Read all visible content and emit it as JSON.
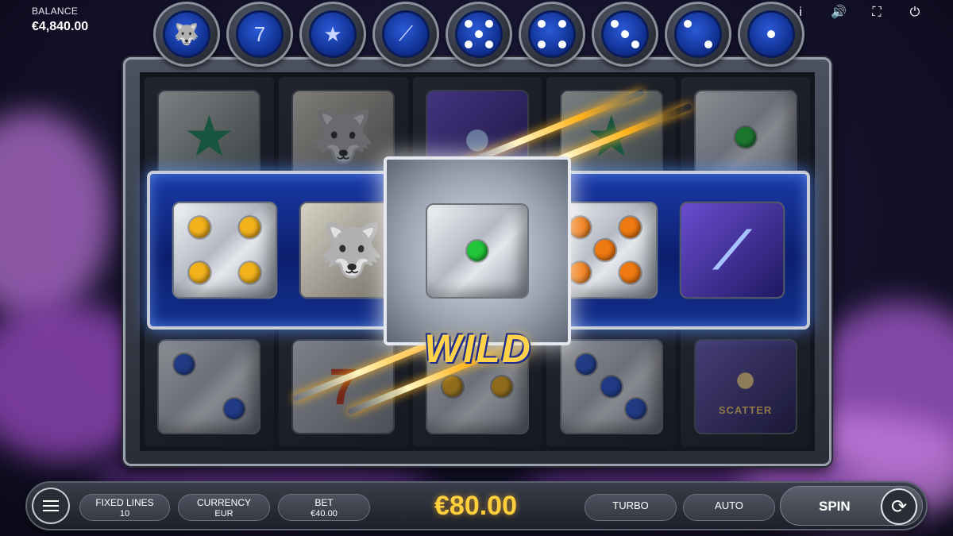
{
  "balance": {
    "label": "BALANCE",
    "value": "€4,840.00"
  },
  "top_icons": {
    "info": "i",
    "sound": "🔊",
    "fullscreen": "⛶",
    "power": "⏻"
  },
  "paytable": [
    {
      "icon": "wolf-icon",
      "glyph": "🐺"
    },
    {
      "icon": "seven-icon",
      "glyph": "7"
    },
    {
      "icon": "star-icon",
      "glyph": "★"
    },
    {
      "icon": "claw-icon",
      "glyph": "⟋"
    },
    {
      "icon": "dice-five-icon",
      "pips": [
        1,
        0,
        1,
        0,
        1,
        0,
        1,
        0,
        1
      ]
    },
    {
      "icon": "dice-four-icon",
      "pips": [
        1,
        0,
        1,
        0,
        0,
        0,
        1,
        0,
        1
      ]
    },
    {
      "icon": "dice-three-icon",
      "pips": [
        1,
        0,
        0,
        0,
        1,
        0,
        0,
        0,
        1
      ]
    },
    {
      "icon": "dice-two-icon",
      "pips": [
        1,
        0,
        0,
        0,
        0,
        0,
        0,
        0,
        1
      ]
    },
    {
      "icon": "dice-one-icon",
      "pips": [
        0,
        0,
        0,
        0,
        1,
        0,
        0,
        0,
        0
      ]
    }
  ],
  "reels": {
    "top_row": [
      "star",
      "wolf",
      "scatter-moon",
      "star",
      "die-1-green"
    ],
    "middle_row": [
      "die-4-yellow",
      "wolf",
      "wild-die-1-green",
      "die-5-orange",
      "claw"
    ],
    "bottom_row": [
      "die-2-blue",
      "seven",
      "die-2-yellow",
      "die-3-blue",
      "scatter"
    ]
  },
  "wild_label": "WILD",
  "scatter_label": "SCATTER",
  "colors": {
    "pip_yellow": "#f2b21c",
    "pip_orange": "#f07a12",
    "pip_green": "#22c43a",
    "pip_blue": "#2a58d8",
    "win_accent": "#ffcf3c"
  },
  "bottom_bar": {
    "fixed_lines": {
      "label": "FIXED LINES",
      "value": "10"
    },
    "currency": {
      "label": "CURRENCY",
      "value": "EUR"
    },
    "bet": {
      "label": "BET",
      "value": "€40.00"
    },
    "win_amount": "€80.00",
    "turbo": "TURBO",
    "auto": "AUTO",
    "spin": "SPIN"
  }
}
